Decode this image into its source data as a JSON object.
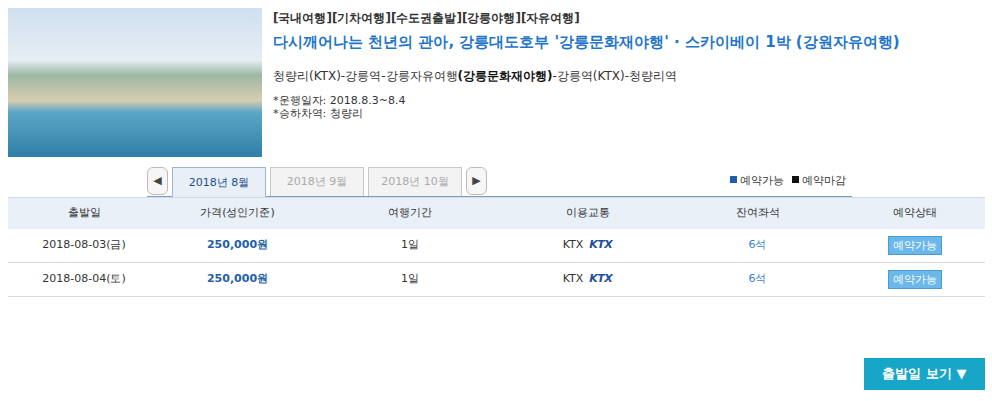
{
  "product": {
    "categories": "[국내여행][기차여행][수도권출발][강릉야행][자유여행]",
    "title": "다시깨어나는 천년의 관아, 강릉대도호부 '강릉문화재야행' · 스카이베이 1박 (강원자유여행)",
    "route": [
      {
        "text": "청량리(KTX)-강릉역-강릉자유여행",
        "bold": false
      },
      {
        "text": "(강릉문화재야행)",
        "bold": true
      },
      {
        "text": "-강릉역(KTX)-청량리역",
        "bold": false
      }
    ],
    "details": [
      "*운행일자: 2018.8.3~8.4",
      "*승하차역: 청량리"
    ]
  },
  "months": {
    "prev": "◀",
    "next": "▶",
    "tabs": [
      {
        "label": "2018년 8월",
        "selected": true
      },
      {
        "label": "2018년 9월",
        "selected": false
      },
      {
        "label": "2018년 10월",
        "selected": false
      }
    ]
  },
  "legend": [
    {
      "label": "예약가능",
      "color": "#1d5fa8"
    },
    {
      "label": "예약마감",
      "color": "#111111"
    }
  ],
  "table": {
    "columns": [
      "출발일",
      "가격(성인기준)",
      "여행기간",
      "이용교통",
      "잔여좌석",
      "예약상태"
    ],
    "rows": [
      {
        "date": "2018-08-03(금)",
        "price": "250,000원",
        "duration": "1일",
        "transport": "KTX",
        "transport_logo": "KTX",
        "seats": "6석",
        "status": "예약가능"
      },
      {
        "date": "2018-08-04(토)",
        "price": "250,000원",
        "duration": "1일",
        "transport": "KTX",
        "transport_logo": "KTX",
        "seats": "6석",
        "status": "예약가능"
      }
    ]
  },
  "more_button": {
    "label": "출발일 보기",
    "icon": "▼"
  }
}
